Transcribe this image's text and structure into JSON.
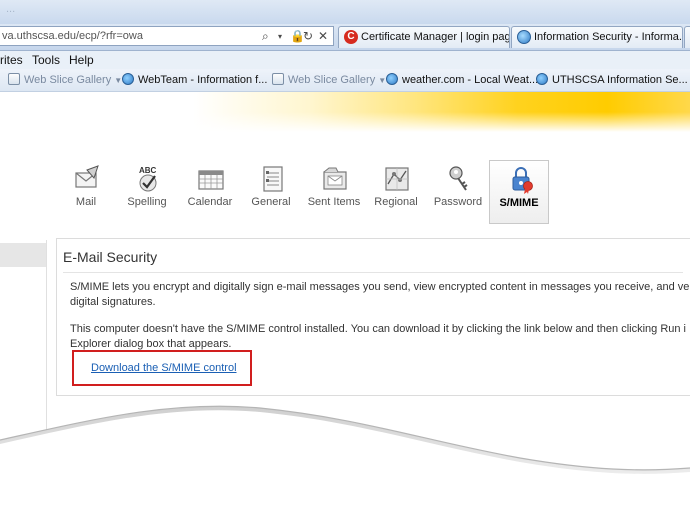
{
  "browser": {
    "address_url": "va.uthscsa.edu/ecp/?rfr=owa",
    "title_partial": "...",
    "tabs": [
      {
        "label": "Certificate Manager | login page",
        "favicon": "c-red-icon",
        "favicon_letter": "C",
        "color": "#d62b1f"
      },
      {
        "label": "Information Security - Informa...",
        "favicon": "ie-page-icon",
        "color": "#3a7cc4"
      }
    ],
    "menus": [
      "rites",
      "Tools",
      "Help"
    ],
    "favorites": [
      {
        "label": "Web Slice Gallery",
        "icon": "web-slice-icon",
        "dim": true,
        "dropdown": true
      },
      {
        "label": "WebTeam - Information f...",
        "icon": "ie-page-icon",
        "dim": false,
        "dropdown": false
      },
      {
        "label": "Web Slice Gallery",
        "icon": "web-slice-icon",
        "dim": true,
        "dropdown": true
      },
      {
        "label": "weather.com - Local Weat...",
        "icon": "ie-page-icon",
        "dim": false,
        "dropdown": false
      },
      {
        "label": "UTHSCSA Information Se...",
        "icon": "ie-page-icon",
        "dim": false,
        "dropdown": false
      }
    ]
  },
  "options_toolbar": [
    {
      "label": "Mail",
      "icon": "mail-icon"
    },
    {
      "label": "Spelling",
      "icon": "spelling-icon"
    },
    {
      "label": "Calendar",
      "icon": "calendar-icon"
    },
    {
      "label": "General",
      "icon": "general-icon"
    },
    {
      "label": "Sent Items",
      "icon": "sent-items-icon"
    },
    {
      "label": "Regional",
      "icon": "regional-icon"
    },
    {
      "label": "Password",
      "icon": "password-icon"
    },
    {
      "label": "S/MIME",
      "icon": "smime-icon",
      "selected": true
    }
  ],
  "email_security": {
    "heading": "E-Mail Security",
    "para1_line1": "S/MIME lets you encrypt and digitally sign e-mail messages you send, view encrypted content in messages you receive, and ve",
    "para1_line2": "digital signatures.",
    "para2_line1": "This computer doesn't have the S/MIME control installed. You can download it by clicking the link below and then clicking Run i",
    "para2_line2": "Explorer dialog box that appears.",
    "download_link": "Download the S/MIME control"
  },
  "colors": {
    "highlight_box": "#d11e1e",
    "link": "#1a5fb4",
    "banner_accent": "#ffcc00"
  }
}
